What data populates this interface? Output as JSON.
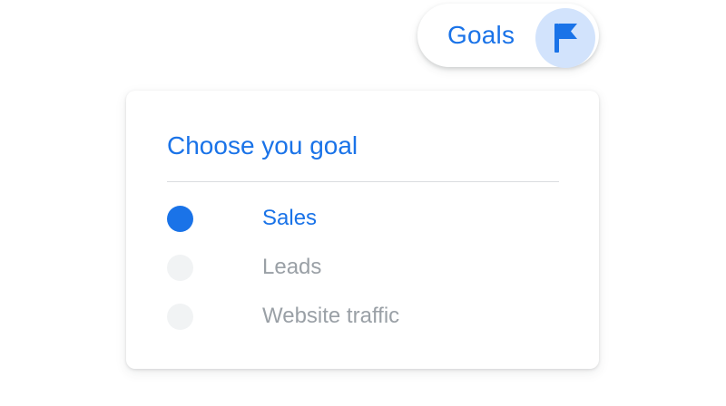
{
  "goals_pill": {
    "label": "Goals",
    "icon": "flag-icon"
  },
  "goal_card": {
    "title": "Choose you goal",
    "options": [
      {
        "label": "Sales",
        "selected": true
      },
      {
        "label": "Leads",
        "selected": false
      },
      {
        "label": "Website traffic",
        "selected": false
      }
    ]
  },
  "colors": {
    "accent": "#1a73e8",
    "accent_light": "#d2e3fc",
    "muted_text": "#9aa0a6",
    "radio_unselected": "#f1f3f4",
    "divider": "#dadce0"
  }
}
